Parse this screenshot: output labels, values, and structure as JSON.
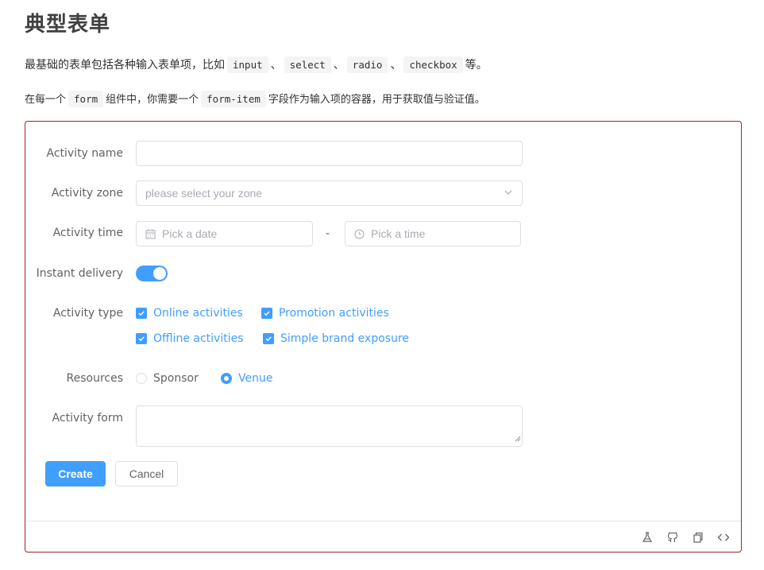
{
  "page": {
    "title": "典型表单",
    "desc1": {
      "pre": "最基础的表单包括各种输入表单项，比如",
      "c1": "input",
      "sep1": "、",
      "c2": "select",
      "sep2": "、",
      "c3": "radio",
      "sep3": "、",
      "c4": "checkbox",
      "post": "等。"
    },
    "desc2": {
      "pre": "在每一个",
      "c1": "form",
      "mid": "组件中，你需要一个",
      "c2": "form-item",
      "post": "字段作为输入项的容器，用于获取值与验证值。"
    }
  },
  "form": {
    "name": {
      "label": "Activity name",
      "value": ""
    },
    "zone": {
      "label": "Activity zone",
      "placeholder": "please select your zone"
    },
    "time": {
      "label": "Activity time",
      "date_placeholder": "Pick a date",
      "separator": "-",
      "time_placeholder": "Pick a time"
    },
    "delivery": {
      "label": "Instant delivery",
      "on": true
    },
    "type": {
      "label": "Activity type",
      "options": [
        {
          "label": "Online activities",
          "checked": true
        },
        {
          "label": "Promotion activities",
          "checked": true
        },
        {
          "label": "Offline activities",
          "checked": true
        },
        {
          "label": "Simple brand exposure",
          "checked": true
        }
      ]
    },
    "resources": {
      "label": "Resources",
      "options": [
        {
          "label": "Sponsor",
          "checked": false
        },
        {
          "label": "Venue",
          "checked": true
        }
      ]
    },
    "desc": {
      "label": "Activity form",
      "value": ""
    },
    "buttons": {
      "create": "Create",
      "cancel": "Cancel"
    }
  },
  "footer_icons": [
    "flask-icon",
    "github-icon",
    "copy-icon",
    "code-icon"
  ],
  "colors": {
    "primary": "#409eff",
    "border": "#dcdfe6",
    "demo_border": "#a3242b"
  }
}
